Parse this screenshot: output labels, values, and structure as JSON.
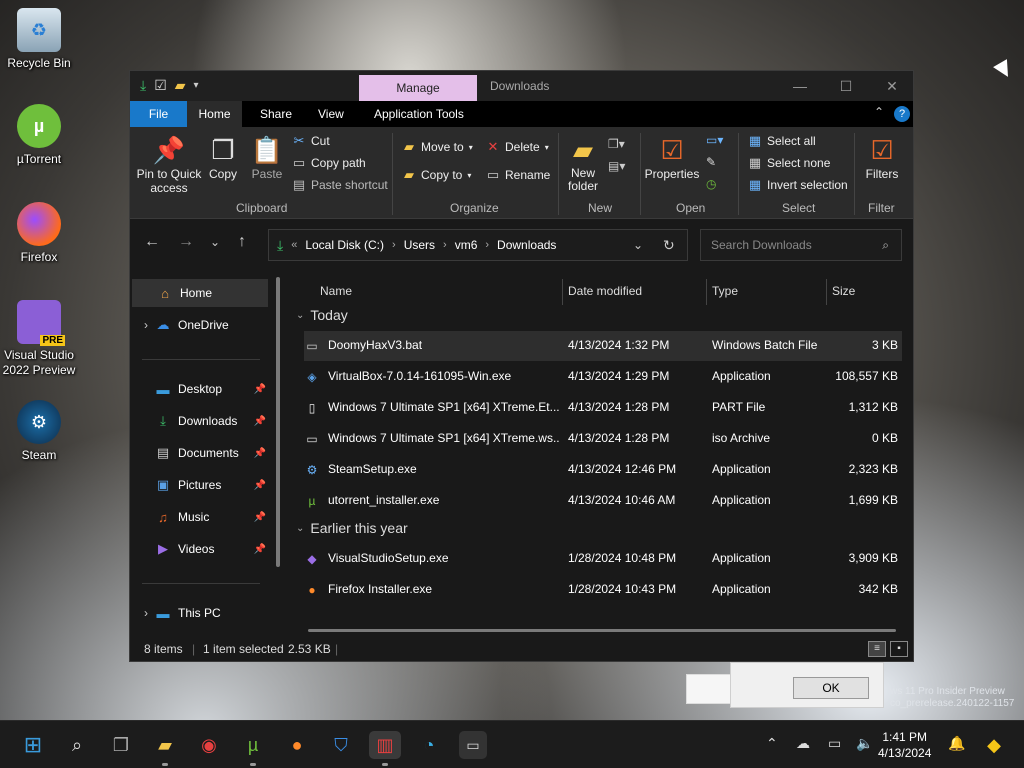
{
  "desktop": {
    "icons": [
      {
        "label": "Recycle Bin",
        "icon": "recycle-bin-icon"
      },
      {
        "label": "µTorrent",
        "icon": "utorrent-icon"
      },
      {
        "label": "Firefox",
        "icon": "firefox-icon"
      },
      {
        "label": "Visual Studio 2022 Preview",
        "badge": "PRE",
        "icon": "visual-studio-icon"
      },
      {
        "label": "Steam",
        "icon": "steam-icon"
      }
    ]
  },
  "window": {
    "title": "Downloads",
    "contextual_tab": "Manage",
    "tabs": [
      "File",
      "Home",
      "Share",
      "View",
      "Application Tools"
    ],
    "help": "?",
    "ribbon": {
      "clipboard": {
        "label": "Clipboard",
        "pin": "Pin to Quick access",
        "copy": "Copy",
        "paste": "Paste",
        "cut": "Cut",
        "copy_path": "Copy path",
        "paste_shortcut": "Paste shortcut"
      },
      "organize": {
        "label": "Organize",
        "move_to": "Move to",
        "copy_to": "Copy to",
        "delete": "Delete",
        "rename": "Rename"
      },
      "new": {
        "label": "New",
        "new_folder": "New folder"
      },
      "open": {
        "label": "Open",
        "properties": "Properties"
      },
      "select": {
        "label": "Select",
        "select_all": "Select all",
        "select_none": "Select none",
        "invert": "Invert selection"
      },
      "filter": {
        "label": "Filter",
        "filters": "Filters"
      }
    },
    "address": {
      "crumbs": [
        "Local Disk (C:)",
        "Users",
        "vm6",
        "Downloads"
      ]
    },
    "search": {
      "placeholder": "Search Downloads"
    },
    "nav": {
      "items": [
        {
          "label": "Home",
          "icon": "home-icon"
        },
        {
          "label": "OneDrive",
          "icon": "onedrive-icon"
        },
        {
          "label": "Desktop",
          "icon": "desktop-icon"
        },
        {
          "label": "Downloads",
          "icon": "downloads-icon"
        },
        {
          "label": "Documents",
          "icon": "documents-icon"
        },
        {
          "label": "Pictures",
          "icon": "pictures-icon"
        },
        {
          "label": "Music",
          "icon": "music-icon"
        },
        {
          "label": "Videos",
          "icon": "videos-icon"
        },
        {
          "label": "This PC",
          "icon": "this-pc-icon"
        }
      ]
    },
    "columns": [
      "Name",
      "Date modified",
      "Type",
      "Size"
    ],
    "groups": [
      {
        "name": "Today",
        "files": [
          {
            "name": "DoomyHaxV3.bat",
            "date": "4/13/2024 1:32 PM",
            "type": "Windows Batch File",
            "size": "3 KB",
            "icon": "batch-file-icon"
          },
          {
            "name": "VirtualBox-7.0.14-161095-Win.exe",
            "date": "4/13/2024 1:29 PM",
            "type": "Application",
            "size": "108,557 KB",
            "icon": "virtualbox-icon"
          },
          {
            "name": "Windows 7 Ultimate SP1 [x64] XTreme.Et...",
            "date": "4/13/2024 1:28 PM",
            "type": "PART File",
            "size": "1,312 KB",
            "icon": "file-icon"
          },
          {
            "name": "Windows 7 Ultimate SP1 [x64] XTreme.ws...",
            "date": "4/13/2024 1:28 PM",
            "type": "iso Archive",
            "size": "0 KB",
            "icon": "iso-icon"
          },
          {
            "name": "SteamSetup.exe",
            "date": "4/13/2024 12:46 PM",
            "type": "Application",
            "size": "2,323 KB",
            "icon": "steam-icon"
          },
          {
            "name": "utorrent_installer.exe",
            "date": "4/13/2024 10:46 AM",
            "type": "Application",
            "size": "1,699 KB",
            "icon": "utorrent-icon"
          }
        ]
      },
      {
        "name": "Earlier this year",
        "files": [
          {
            "name": "VisualStudioSetup.exe",
            "date": "1/28/2024 10:48 PM",
            "type": "Application",
            "size": "3,909 KB",
            "icon": "visual-studio-icon"
          },
          {
            "name": "Firefox Installer.exe",
            "date": "1/28/2024 10:43 PM",
            "type": "Application",
            "size": "342 KB",
            "icon": "firefox-icon"
          }
        ]
      }
    ],
    "status": {
      "items": "8 items",
      "selected": "1 item selected",
      "size": "2.53 KB"
    }
  },
  "dialog": {
    "ok": "OK"
  },
  "watermark": {
    "line1": "ws 11 Pro Insider Preview",
    "line2": "co_prerelease.240122-1157"
  },
  "taskbar": {
    "time": "1:41 PM",
    "date": "4/13/2024"
  },
  "colors": {
    "accent": "#1979ca",
    "manage_tab": "#e4bfe9",
    "window_bg": "#191919",
    "ribbon_bg": "#2b2b2b"
  }
}
